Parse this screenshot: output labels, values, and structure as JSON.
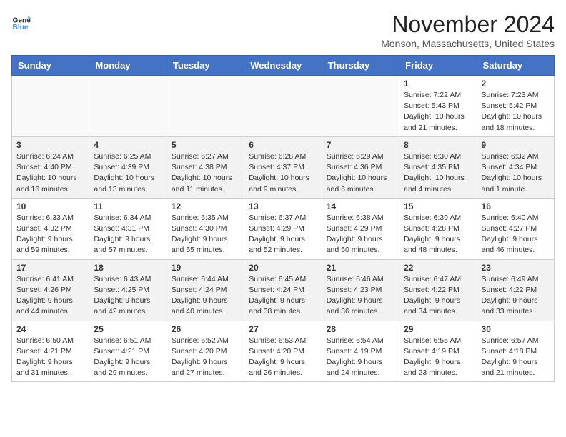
{
  "header": {
    "logo_line1": "General",
    "logo_line2": "Blue",
    "month": "November 2024",
    "location": "Monson, Massachusetts, United States"
  },
  "weekdays": [
    "Sunday",
    "Monday",
    "Tuesday",
    "Wednesday",
    "Thursday",
    "Friday",
    "Saturday"
  ],
  "weeks": [
    [
      {
        "day": "",
        "info": ""
      },
      {
        "day": "",
        "info": ""
      },
      {
        "day": "",
        "info": ""
      },
      {
        "day": "",
        "info": ""
      },
      {
        "day": "",
        "info": ""
      },
      {
        "day": "1",
        "info": "Sunrise: 7:22 AM\nSunset: 5:43 PM\nDaylight: 10 hours and 21 minutes."
      },
      {
        "day": "2",
        "info": "Sunrise: 7:23 AM\nSunset: 5:42 PM\nDaylight: 10 hours and 18 minutes."
      }
    ],
    [
      {
        "day": "3",
        "info": "Sunrise: 6:24 AM\nSunset: 4:40 PM\nDaylight: 10 hours and 16 minutes."
      },
      {
        "day": "4",
        "info": "Sunrise: 6:25 AM\nSunset: 4:39 PM\nDaylight: 10 hours and 13 minutes."
      },
      {
        "day": "5",
        "info": "Sunrise: 6:27 AM\nSunset: 4:38 PM\nDaylight: 10 hours and 11 minutes."
      },
      {
        "day": "6",
        "info": "Sunrise: 6:28 AM\nSunset: 4:37 PM\nDaylight: 10 hours and 9 minutes."
      },
      {
        "day": "7",
        "info": "Sunrise: 6:29 AM\nSunset: 4:36 PM\nDaylight: 10 hours and 6 minutes."
      },
      {
        "day": "8",
        "info": "Sunrise: 6:30 AM\nSunset: 4:35 PM\nDaylight: 10 hours and 4 minutes."
      },
      {
        "day": "9",
        "info": "Sunrise: 6:32 AM\nSunset: 4:34 PM\nDaylight: 10 hours and 1 minute."
      }
    ],
    [
      {
        "day": "10",
        "info": "Sunrise: 6:33 AM\nSunset: 4:32 PM\nDaylight: 9 hours and 59 minutes."
      },
      {
        "day": "11",
        "info": "Sunrise: 6:34 AM\nSunset: 4:31 PM\nDaylight: 9 hours and 57 minutes."
      },
      {
        "day": "12",
        "info": "Sunrise: 6:35 AM\nSunset: 4:30 PM\nDaylight: 9 hours and 55 minutes."
      },
      {
        "day": "13",
        "info": "Sunrise: 6:37 AM\nSunset: 4:29 PM\nDaylight: 9 hours and 52 minutes."
      },
      {
        "day": "14",
        "info": "Sunrise: 6:38 AM\nSunset: 4:29 PM\nDaylight: 9 hours and 50 minutes."
      },
      {
        "day": "15",
        "info": "Sunrise: 6:39 AM\nSunset: 4:28 PM\nDaylight: 9 hours and 48 minutes."
      },
      {
        "day": "16",
        "info": "Sunrise: 6:40 AM\nSunset: 4:27 PM\nDaylight: 9 hours and 46 minutes."
      }
    ],
    [
      {
        "day": "17",
        "info": "Sunrise: 6:41 AM\nSunset: 4:26 PM\nDaylight: 9 hours and 44 minutes."
      },
      {
        "day": "18",
        "info": "Sunrise: 6:43 AM\nSunset: 4:25 PM\nDaylight: 9 hours and 42 minutes."
      },
      {
        "day": "19",
        "info": "Sunrise: 6:44 AM\nSunset: 4:24 PM\nDaylight: 9 hours and 40 minutes."
      },
      {
        "day": "20",
        "info": "Sunrise: 6:45 AM\nSunset: 4:24 PM\nDaylight: 9 hours and 38 minutes."
      },
      {
        "day": "21",
        "info": "Sunrise: 6:46 AM\nSunset: 4:23 PM\nDaylight: 9 hours and 36 minutes."
      },
      {
        "day": "22",
        "info": "Sunrise: 6:47 AM\nSunset: 4:22 PM\nDaylight: 9 hours and 34 minutes."
      },
      {
        "day": "23",
        "info": "Sunrise: 6:49 AM\nSunset: 4:22 PM\nDaylight: 9 hours and 33 minutes."
      }
    ],
    [
      {
        "day": "24",
        "info": "Sunrise: 6:50 AM\nSunset: 4:21 PM\nDaylight: 9 hours and 31 minutes."
      },
      {
        "day": "25",
        "info": "Sunrise: 6:51 AM\nSunset: 4:21 PM\nDaylight: 9 hours and 29 minutes."
      },
      {
        "day": "26",
        "info": "Sunrise: 6:52 AM\nSunset: 4:20 PM\nDaylight: 9 hours and 27 minutes."
      },
      {
        "day": "27",
        "info": "Sunrise: 6:53 AM\nSunset: 4:20 PM\nDaylight: 9 hours and 26 minutes."
      },
      {
        "day": "28",
        "info": "Sunrise: 6:54 AM\nSunset: 4:19 PM\nDaylight: 9 hours and 24 minutes."
      },
      {
        "day": "29",
        "info": "Sunrise: 6:55 AM\nSunset: 4:19 PM\nDaylight: 9 hours and 23 minutes."
      },
      {
        "day": "30",
        "info": "Sunrise: 6:57 AM\nSunset: 4:18 PM\nDaylight: 9 hours and 21 minutes."
      }
    ]
  ]
}
